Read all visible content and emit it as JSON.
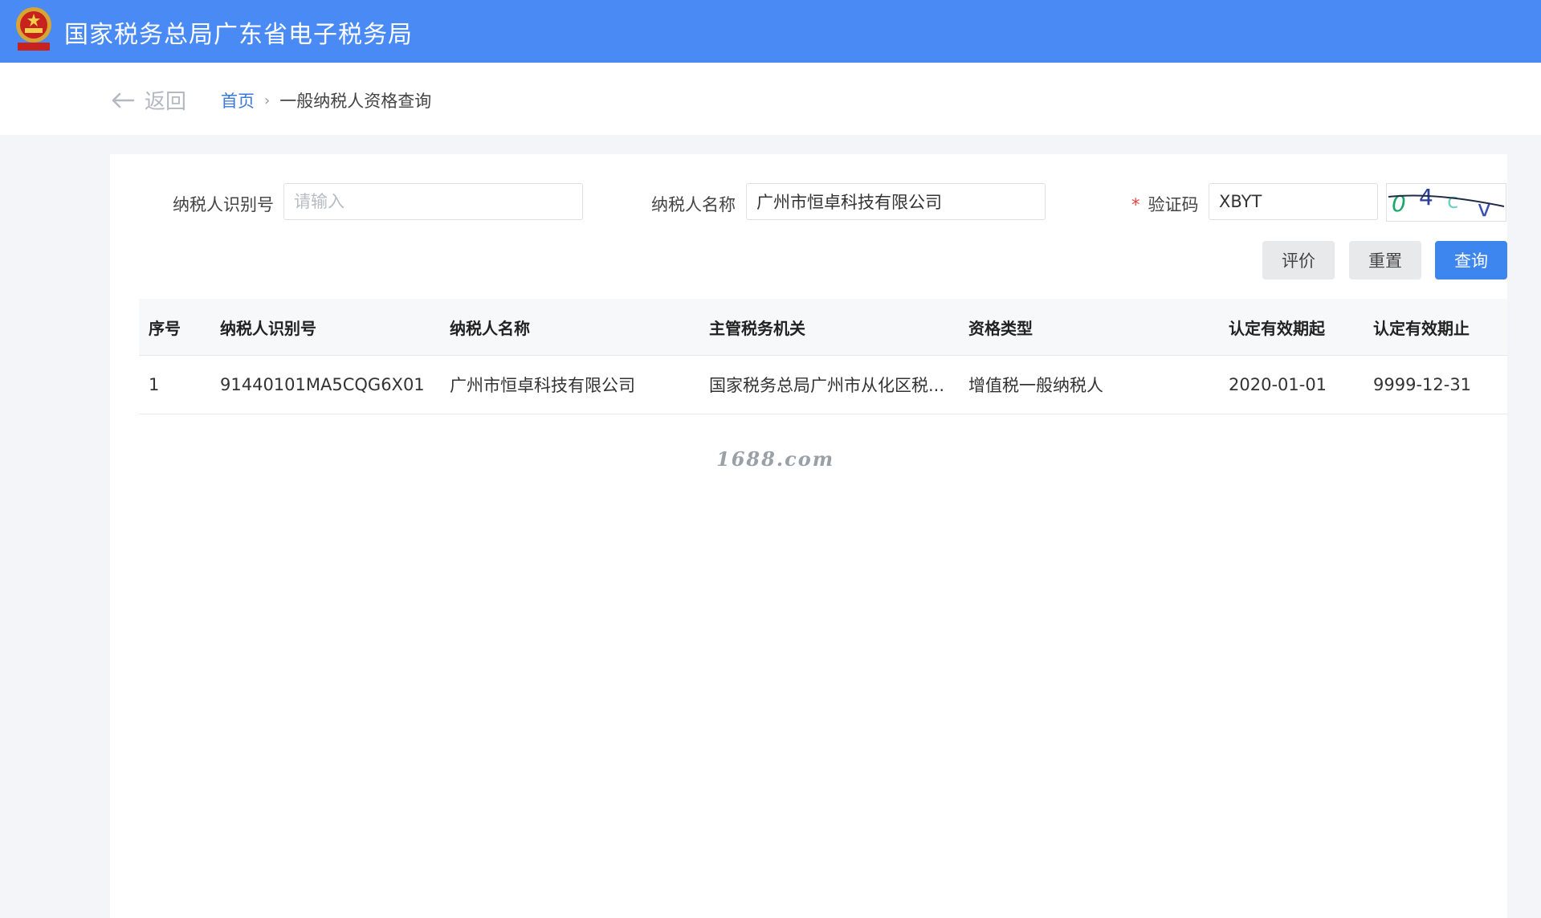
{
  "header": {
    "title": "国家税务总局广东省电子税务局",
    "brand_color": "#4a8af4"
  },
  "nav": {
    "back_label": "返回",
    "breadcrumb_home": "首页",
    "breadcrumb_separator": "›",
    "breadcrumb_current": "一般纳税人资格查询"
  },
  "form": {
    "taxpayer_id": {
      "label": "纳税人识别号",
      "value": "",
      "placeholder": "请输入"
    },
    "taxpayer_name": {
      "label": "纳税人名称",
      "value": "广州市恒卓科技有限公司",
      "placeholder": ""
    },
    "captcha": {
      "required_mark": "*",
      "label": "验证码",
      "value": "XBYT",
      "image_text": "04cv"
    }
  },
  "buttons": {
    "evaluate": "评价",
    "reset": "重置",
    "query": "查询"
  },
  "table": {
    "headers": [
      "序号",
      "纳税人识别号",
      "纳税人名称",
      "主管税务机关",
      "资格类型",
      "认定有效期起",
      "认定有效期止"
    ],
    "rows": [
      [
        "1",
        "91440101MA5CQG6X01",
        "广州市恒卓科技有限公司",
        "国家税务总局广州市从化区税...",
        "增值税一般纳税人",
        "2020-01-01",
        "9999-12-31"
      ]
    ]
  },
  "watermark": "1688.com",
  "colors": {
    "accent": "#3d86f0",
    "required": "#e0413a",
    "link": "#3a79d8"
  }
}
